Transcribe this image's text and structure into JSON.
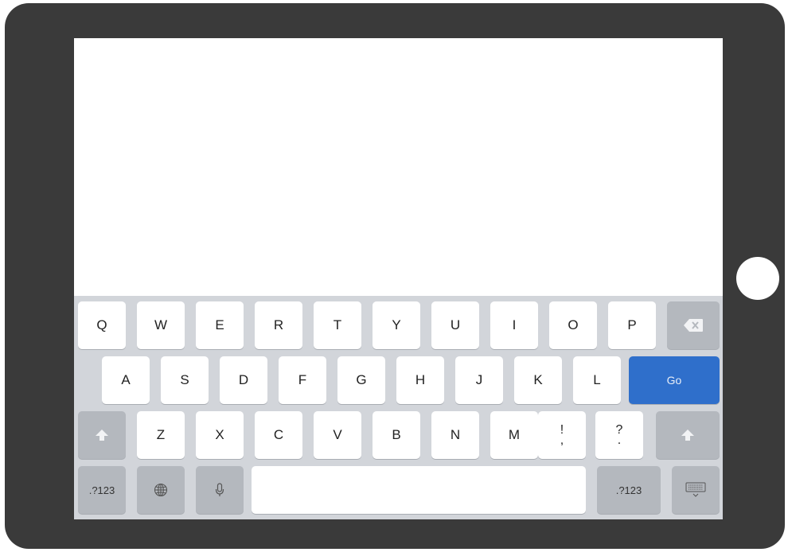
{
  "keyboard": {
    "row1": [
      "Q",
      "W",
      "E",
      "R",
      "T",
      "Y",
      "U",
      "I",
      "O",
      "P"
    ],
    "row2": [
      "A",
      "S",
      "D",
      "F",
      "G",
      "H",
      "J",
      "K",
      "L"
    ],
    "row3": [
      "Z",
      "X",
      "C",
      "V",
      "B",
      "N",
      "M"
    ],
    "punct1": {
      "top": "!",
      "bottom": ","
    },
    "punct2": {
      "top": "?",
      "bottom": "."
    },
    "go_label": "Go",
    "numbers_left_label": ".?123",
    "numbers_right_label": ".?123"
  },
  "icons": {
    "backspace": "backspace-icon",
    "shift": "shift-icon",
    "globe": "globe-icon",
    "microphone": "microphone-icon",
    "dismiss_keyboard": "keyboard-dismiss-icon"
  },
  "colors": {
    "bezel": "#3a3a3a",
    "keyboard_bg": "#d2d5da",
    "key": "#ffffff",
    "function_key": "#b4b8be",
    "go_key": "#2f6fcb"
  }
}
